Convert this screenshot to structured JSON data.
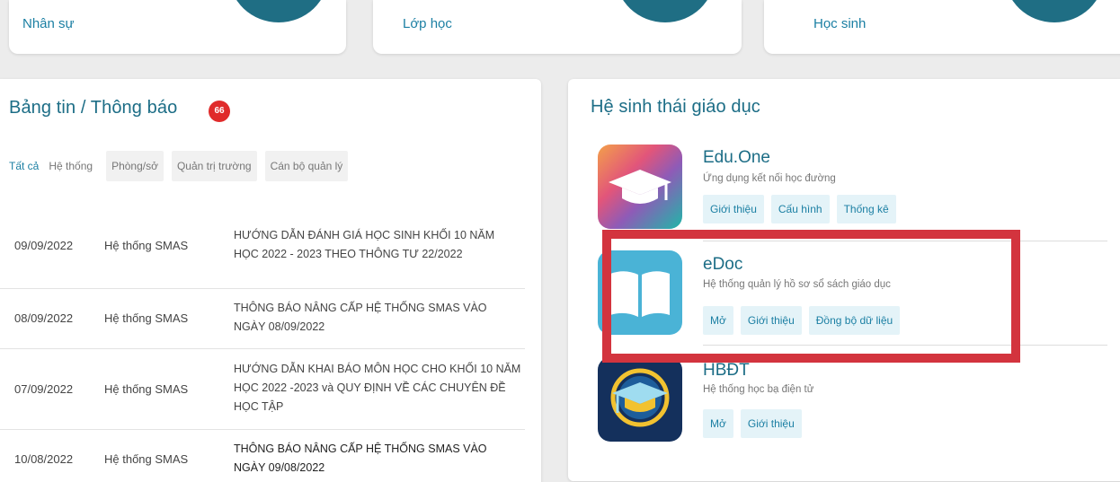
{
  "stat_cards": [
    {
      "label": "Nhân sự"
    },
    {
      "label": "Lớp học"
    },
    {
      "label": "Học sinh"
    }
  ],
  "news": {
    "title": "Bảng tin / Thông báo",
    "badge": "66",
    "tabs": [
      "Tất cả",
      "Hệ thống",
      "Phòng/sở",
      "Quản trị trường",
      "Cán bộ quản lý"
    ],
    "rows": [
      {
        "date": "09/09/2022",
        "source": "Hệ thống SMAS",
        "title": "HƯỚNG DẪN ĐÁNH GIÁ HỌC SINH KHỐI 10 NĂM HỌC 2022 - 2023 THEO THÔNG TƯ 22/2022"
      },
      {
        "date": "08/09/2022",
        "source": "Hệ thống SMAS",
        "title": "THÔNG BÁO NÂNG CẤP HỆ THỐNG SMAS VÀO NGÀY 08/09/2022"
      },
      {
        "date": "07/09/2022",
        "source": "Hệ thống SMAS",
        "title": "HƯỚNG DẪN KHAI BÁO MÔN HỌC CHO KHỐI 10 NĂM HỌC 2022 -2023 và QUY ĐỊNH VỀ CÁC CHUYÊN ĐỀ HỌC TẬP"
      },
      {
        "date": "10/08/2022",
        "source": "Hệ thống SMAS",
        "title": "THÔNG BÁO NÂNG CẤP HỆ THỐNG SMAS VÀO NGÀY 09/08/2022"
      }
    ]
  },
  "ecosystem": {
    "title": "Hệ sinh thái giáo dục",
    "apps": [
      {
        "name": "Edu.One",
        "desc": "Ứng dụng kết nối học đường",
        "buttons": [
          "Giới thiệu",
          "Cấu hình",
          "Thống kê"
        ],
        "icon": "graduation-cap-icon"
      },
      {
        "name": "eDoc",
        "desc": "Hệ thống quản lý hồ sơ sổ sách giáo dục",
        "buttons": [
          "Mở",
          "Giới thiệu",
          "Đồng bộ dữ liệu"
        ],
        "icon": "open-book-icon"
      },
      {
        "name": "HBĐT",
        "desc": "Hệ thống học bạ điện tử",
        "buttons": [
          "Mở",
          "Giới thiệu"
        ],
        "icon": "hbdt-cap-icon"
      }
    ]
  },
  "colors": {
    "accent": "#1c6d86",
    "badge": "#e02b2b",
    "highlight": "#d3343e",
    "button_bg": "#e4f3f8"
  }
}
